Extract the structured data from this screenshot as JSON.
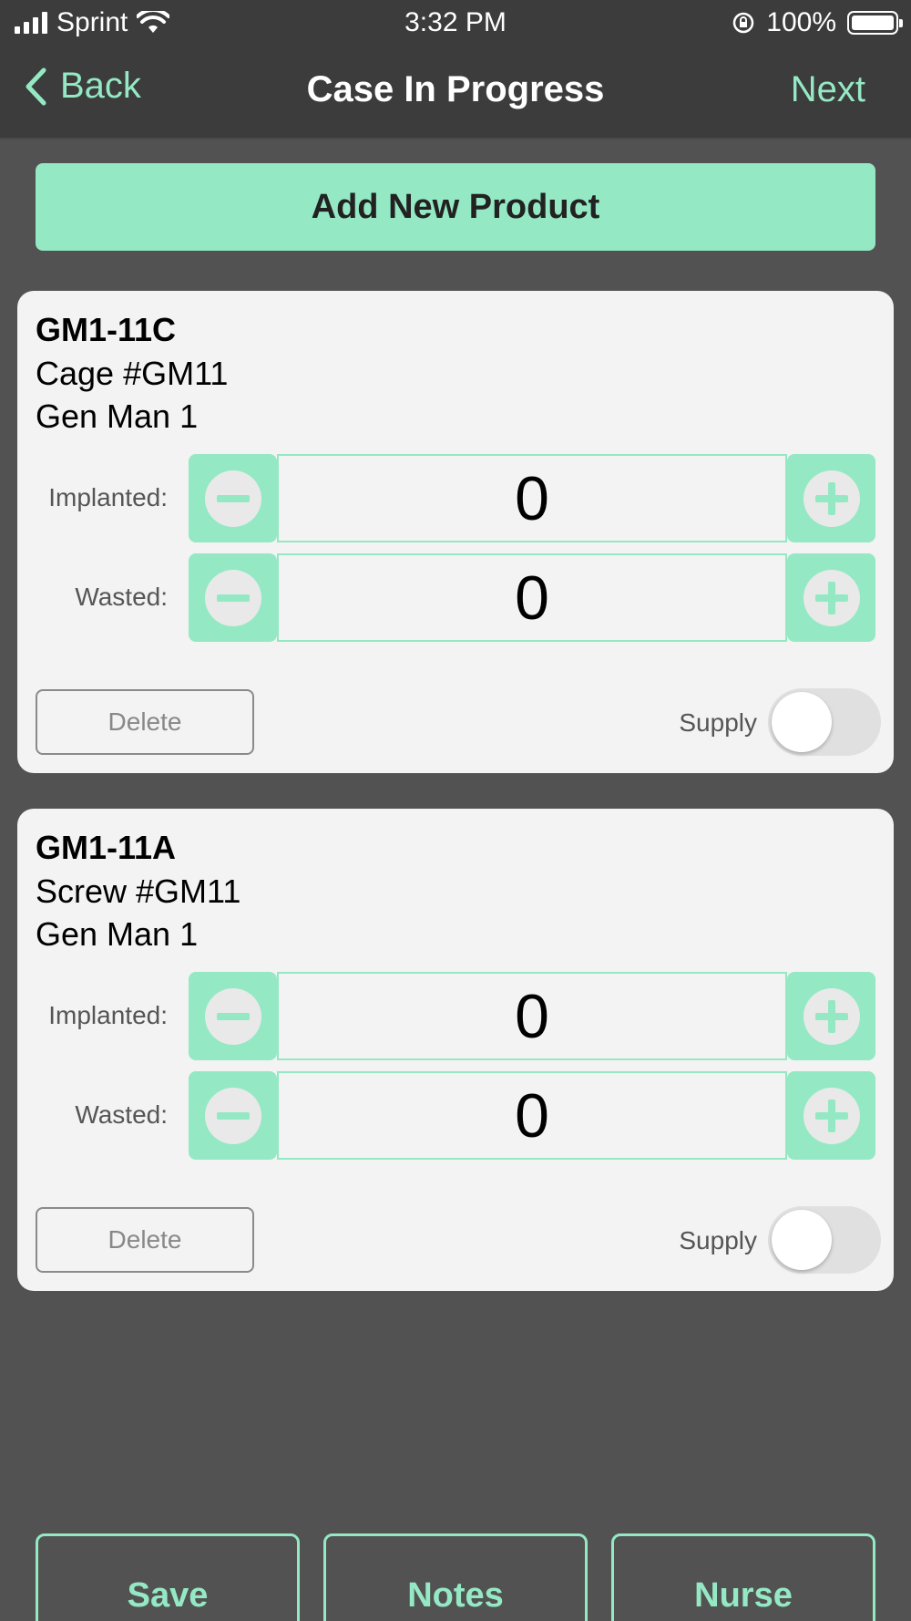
{
  "status_bar": {
    "carrier": "Sprint",
    "time": "3:32 PM",
    "battery": "100%"
  },
  "nav": {
    "back_label": "Back",
    "title": "Case In Progress",
    "next_label": "Next"
  },
  "add_product_label": "Add New Product",
  "products": [
    {
      "code": "GM1-11C",
      "description": "Cage #GM11",
      "manufacturer": "Gen Man 1",
      "implanted_label": "Implanted:",
      "implanted_value": "0",
      "wasted_label": "Wasted:",
      "wasted_value": "0",
      "delete_label": "Delete",
      "supply_label": "Supply",
      "supply_on": false
    },
    {
      "code": "GM1-11A",
      "description": "Screw #GM11",
      "manufacturer": "Gen Man 1",
      "implanted_label": "Implanted:",
      "implanted_value": "0",
      "wasted_label": "Wasted:",
      "wasted_value": "0",
      "delete_label": "Delete",
      "supply_label": "Supply",
      "supply_on": false
    }
  ],
  "footer": {
    "save_label": "Save",
    "notes_label": "Notes",
    "nurse_label": "Nurse"
  },
  "colors": {
    "accent": "#94e9c4",
    "background": "#525252",
    "header": "#3d3c3c",
    "card": "#f3f3f3"
  }
}
